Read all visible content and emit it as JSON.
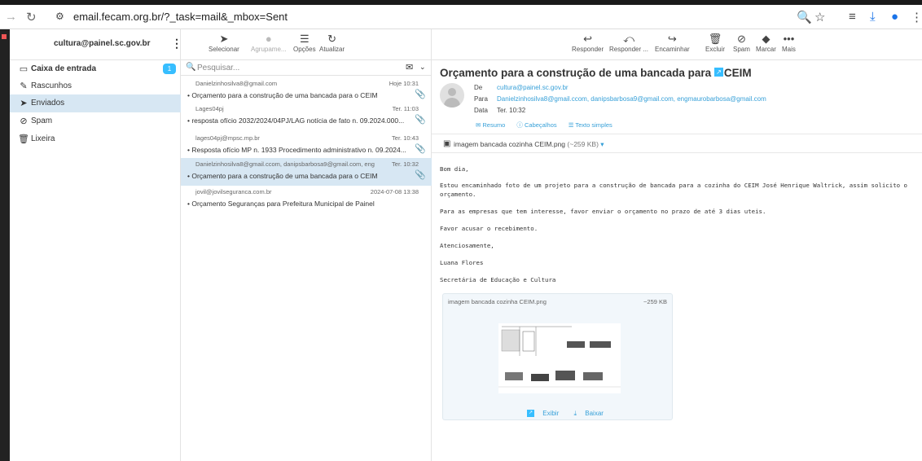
{
  "browser": {
    "url": "email.fecam.org.br/?_task=mail&_mbox=Sent"
  },
  "sidebar": {
    "account": "cultura@painel.sc.gov.br",
    "folders": [
      {
        "label": "Caixa de entrada",
        "icon": "inbox-icon",
        "unread": "1",
        "bold": true
      },
      {
        "label": "Rascunhos",
        "icon": "pencil-icon"
      },
      {
        "label": "Enviados",
        "icon": "paper-plane-icon",
        "selected": true
      },
      {
        "label": "Spam",
        "icon": "spam-icon"
      },
      {
        "label": "Lixeira",
        "icon": "trash-icon"
      }
    ]
  },
  "list_toolbar": {
    "select": "Selecionar",
    "group": "Agrupame...",
    "options": "Opções",
    "refresh": "Atualizar"
  },
  "msg_toolbar": {
    "reply": "Responder",
    "reply_all": "Responder ...",
    "forward": "Encaminhar",
    "delete": "Excluir",
    "spam": "Spam",
    "mark": "Marcar",
    "more": "Mais"
  },
  "search": {
    "placeholder": "Pesquisar..."
  },
  "messages": [
    {
      "from": "Danielzinhosilva8@gmail.com",
      "date": "Hoje 10:31",
      "subject": "Orçamento para a construção de uma bancada para o CEIM",
      "attachment": true
    },
    {
      "from": "Lages04pj",
      "date": "Ter. 11:03",
      "subject": "resposta ofício 2032/2024/04PJ/LAG notícia de fato n. 09.2024.000...",
      "attachment": true
    },
    {
      "from": "lages04pj@mpsc.mp.br",
      "date": "Ter. 10:43",
      "subject": "Resposta ofício MP n. 1933 Procedimento administrativo n. 09.2024...",
      "attachment": true
    },
    {
      "from": "Danielzinhosilva8@gmail.ccom, danipsbarbosa9@gmail.com, eng...",
      "date": "Ter. 10:32",
      "subject": "Orçamento para a construção de uma bancada para o CEIM",
      "attachment": true,
      "selected": true
    },
    {
      "from": "jovil@jovilseguranca.com.br",
      "date": "2024-07-08 13:38",
      "subject": "Orçamento Seguranças para Prefeitura Municipal de Painel",
      "attachment": false
    }
  ],
  "email": {
    "subject": "Orçamento para a construção de uma bancada para o CEIM",
    "from_label": "De",
    "from": "cultura@painel.sc.gov.br",
    "to_label": "Para",
    "to": "Danielzinhosilva8@gmail.ccom, danipsbarbosa9@gmail.com, engmaurobarbosa@gmail.com",
    "date_label": "Data",
    "date": "Ter. 10:32",
    "view_links": [
      "Resumo",
      "Cabeçalhos",
      "Texto simples"
    ],
    "attachment_name": "imagem bancada cozinha CEIM.png",
    "attachment_size": "(~259 KB)",
    "body": [
      "Bom dia,",
      "Estou encaminhado foto de um projeto para a construção de bancada para a cozinha do CEIM José Henrique Waltrick, assim solicito o orçamento.",
      "Para as empresas que tem interesse, favor enviar o orçamento no prazo de até 3 dias uteis.",
      "Favor acusar o recebimento.",
      "Atenciosamente,",
      "Luana Flores",
      "Secretária de Educação e Cultura"
    ],
    "card": {
      "name": "imagem bancada cozinha CEIM.png",
      "size": "~259 KB",
      "view": "Exibir",
      "download": "Baixar"
    }
  }
}
